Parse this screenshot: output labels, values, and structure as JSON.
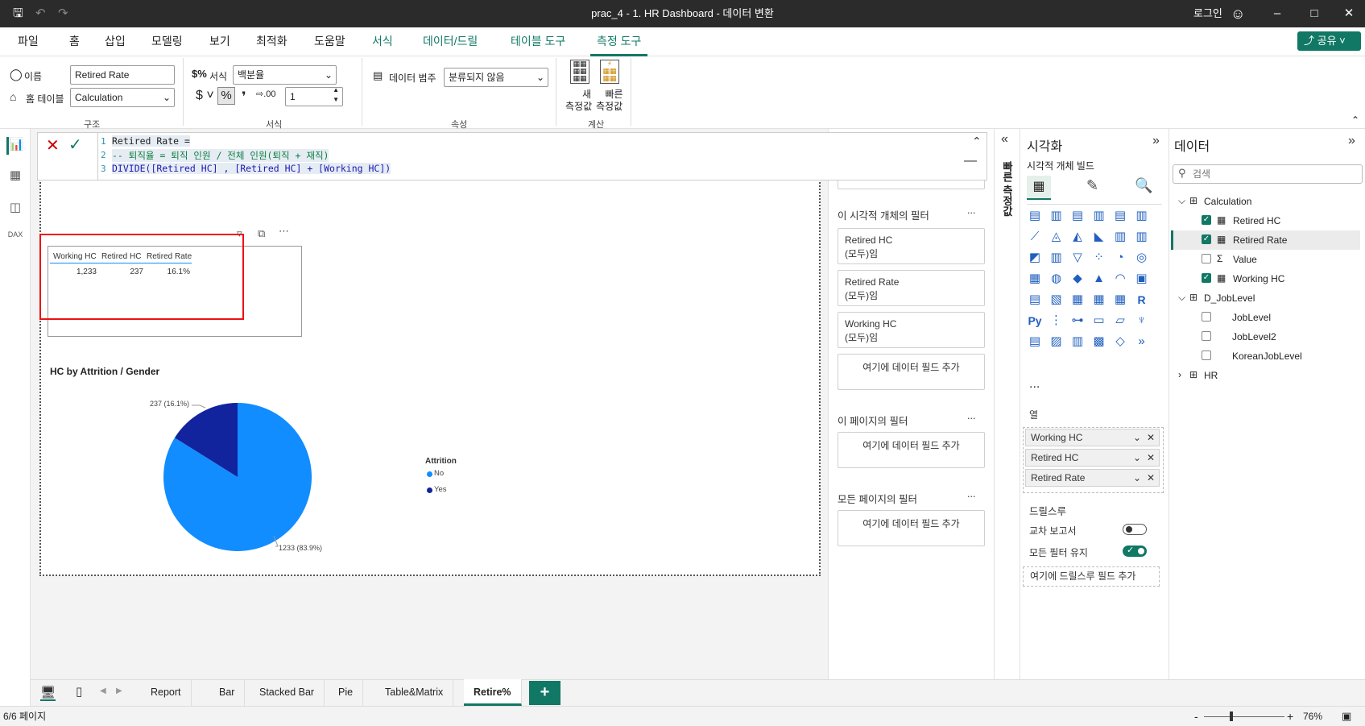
{
  "app": {
    "title": "prac_4 - 1. HR Dashboard - 데이터 변환",
    "login": "로그인"
  },
  "menu": {
    "tabs": [
      "파일",
      "홈",
      "삽입",
      "모델링",
      "보기",
      "최적화",
      "도움말",
      "서식",
      "데이터/드릴",
      "테이블 도구",
      "측정 도구"
    ],
    "share": "공유"
  },
  "ribbon": {
    "name_label": "이름",
    "name_value": "Retired Rate",
    "home_table_label": "홈 테이블",
    "home_table_value": "Calculation",
    "group_structure": "구조",
    "format_label": "서식",
    "format_value": "백분율",
    "decimals_value": "1",
    "group_format": "서식",
    "data_category_label": "데이터 범주",
    "data_category_value": "분류되지 않음",
    "group_properties": "속성",
    "new_measure": "새\n측정값",
    "quick_measure": "빠른\n측정값",
    "new_measure_l1": "새",
    "new_measure_l2": "측정값",
    "quick_measure_l1": "빠른",
    "quick_measure_l2": "측정값",
    "group_calc": "계산"
  },
  "formula": {
    "lines": [
      "Retired Rate =",
      "-- 퇴직율 = 퇴직 인원 / 전체 인원(퇴직 + 재직)",
      "DIVIDE([Retired HC] , [Retired HC] + [Working HC])"
    ],
    "nums": [
      "1",
      "2",
      "3"
    ]
  },
  "table_visual": {
    "headers": [
      "Working HC",
      "Retired HC",
      "Retired Rate"
    ],
    "values": [
      "1,233",
      "237",
      "16.1%"
    ]
  },
  "pie": {
    "title": "HC by Attrition / Gender",
    "legend_title": "Attrition",
    "legend": [
      "No",
      "Yes"
    ],
    "label_yes": "237 (16.1%)",
    "label_no": "1233 (83.9%)"
  },
  "chart_data": {
    "type": "pie",
    "title": "HC by Attrition / Gender",
    "categories": [
      "No",
      "Yes"
    ],
    "values": [
      1233,
      237
    ],
    "percent": [
      83.9,
      16.1
    ],
    "colors": [
      "#118dff",
      "#12239e"
    ],
    "legend_title": "Attrition",
    "legend_position": "right"
  },
  "filters": {
    "visual_header": "이 시각적 개체의 필터",
    "cards": [
      {
        "name": "Retired HC",
        "state": "(모두)임"
      },
      {
        "name": "Retired Rate",
        "state": "(모두)임"
      },
      {
        "name": "Working HC",
        "state": "(모두)임"
      }
    ],
    "add": "여기에 데이터 필드 추가",
    "page_header": "이 페이지의 필터",
    "all_header": "모든 페이지의 필터",
    "more": "...",
    "quick_measure_vertical": "빠른 측정값"
  },
  "viz": {
    "title": "시각화",
    "build": "시각적 개체 빌드",
    "columns_label": "열",
    "wells": [
      "Working HC",
      "Retired HC",
      "Retired Rate"
    ],
    "drill_label": "드릴스루",
    "cross_report": "교차 보고서",
    "keep_filters": "모든 필터 유지",
    "drill_add": "여기에 드릴스루 필드 추가",
    "more": "..."
  },
  "data": {
    "title": "데이터",
    "search_placeholder": "검색",
    "tables": [
      {
        "name": "Calculation",
        "fields": [
          {
            "name": "Retired HC",
            "checked": true
          },
          {
            "name": "Retired Rate",
            "checked": true
          },
          {
            "name": "Value",
            "checked": false
          },
          {
            "name": "Working HC",
            "checked": true
          }
        ]
      },
      {
        "name": "D_JobLevel",
        "fields": [
          {
            "name": "JobLevel",
            "checked": false
          },
          {
            "name": "JobLevel2",
            "checked": false
          },
          {
            "name": "KoreanJobLevel",
            "checked": false
          }
        ]
      },
      {
        "name": "HR",
        "fields": []
      }
    ]
  },
  "pages": {
    "tabs": [
      "Report",
      "Bar",
      "Stacked Bar",
      "Pie",
      "Table&Matrix",
      "Retire%"
    ],
    "active": "Retire%",
    "add": "+"
  },
  "status": {
    "page_info": "6/6 페이지",
    "zoom": "76%"
  }
}
